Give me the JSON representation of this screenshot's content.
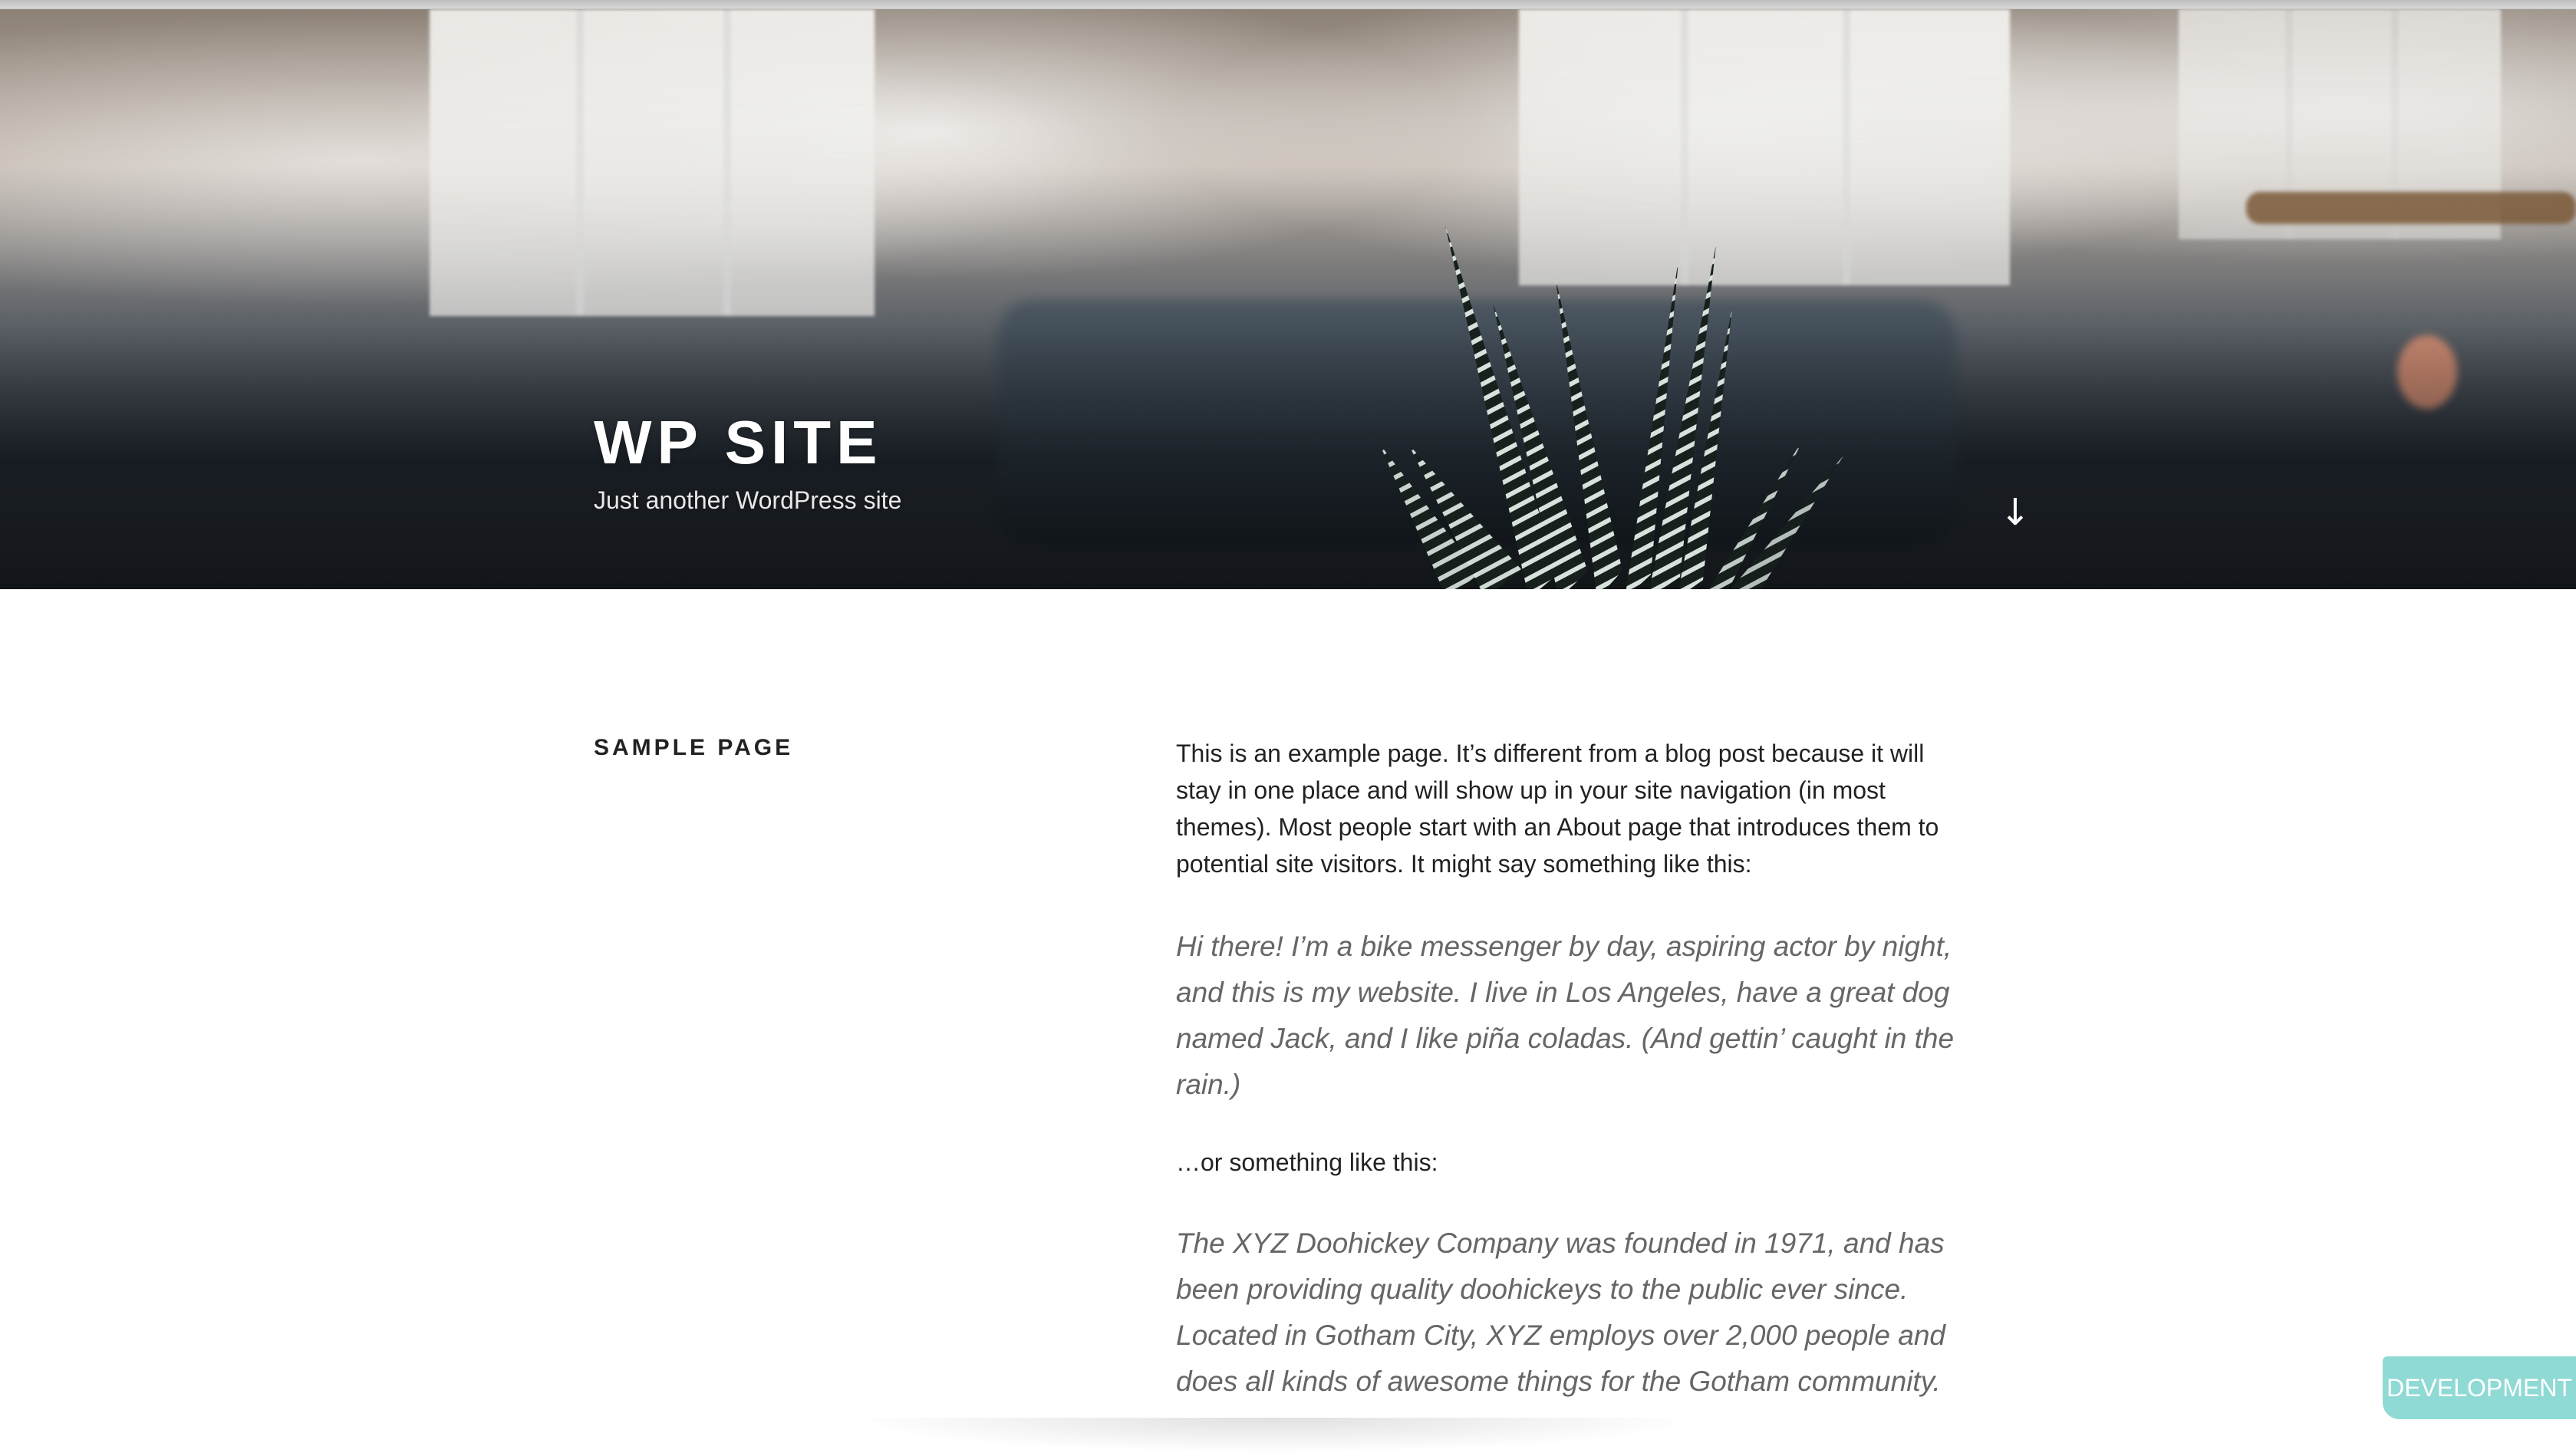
{
  "site": {
    "title": "WP SITE",
    "description": "Just another WordPress site"
  },
  "header": {
    "scroll_icon": "arrow-down-icon",
    "scroll_glyph": "↓"
  },
  "page": {
    "title": "SAMPLE PAGE",
    "intro": "This is an example page. It’s different from a blog post because it will stay in one place and will show up in your site navigation (in most themes). Most people start with an About page that introduces them to potential site visitors. It might say something like this:",
    "quote_one": "Hi there! I’m a bike messenger by day, aspiring actor by night, and this is my website. I live in Los Angeles, have a great dog named Jack, and I like piña coladas. (And gettin’ caught in the rain.)",
    "middle": "…or something like this:",
    "quote_two": "The XYZ Doohickey Company was founded in 1971, and has been providing quality doohickeys to the public ever since. Located in Gotham City, XYZ employs over 2,000 people and does all kinds of awesome things for the Gotham community."
  },
  "badge": {
    "label": "DEVELOPMENT",
    "color": "#8fdad4"
  },
  "colors": {
    "title": "#ffffff",
    "body_text": "#222222",
    "quote_text": "#666666",
    "background": "#ffffff"
  }
}
